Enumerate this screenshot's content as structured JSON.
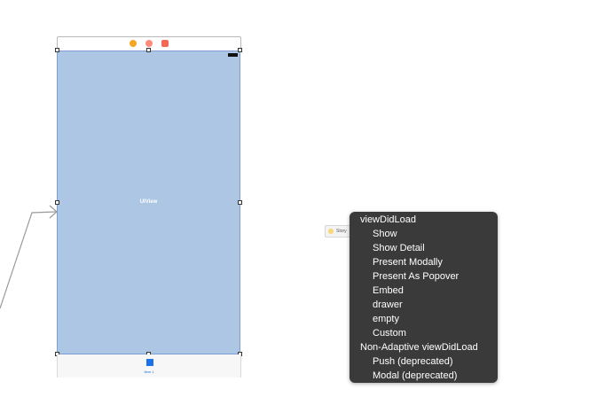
{
  "scene": {
    "view_label": "UIView",
    "tab_item_label": "Item 1"
  },
  "segue_chip": {
    "label": "Story"
  },
  "menu": {
    "section1_header": "viewDidLoad",
    "section1_items": [
      "Show",
      "Show Detail",
      "Present Modally",
      "Present As Popover",
      "Embed",
      "drawer",
      "empty",
      "Custom"
    ],
    "section2_header": "Non-Adaptive viewDidLoad",
    "section2_items": [
      "Push (deprecated)",
      "Modal (deprecated)"
    ]
  },
  "colors": {
    "view_background": "#adc6e4",
    "menu_background": "#3a3a3a",
    "accent": "#1a73e8"
  }
}
